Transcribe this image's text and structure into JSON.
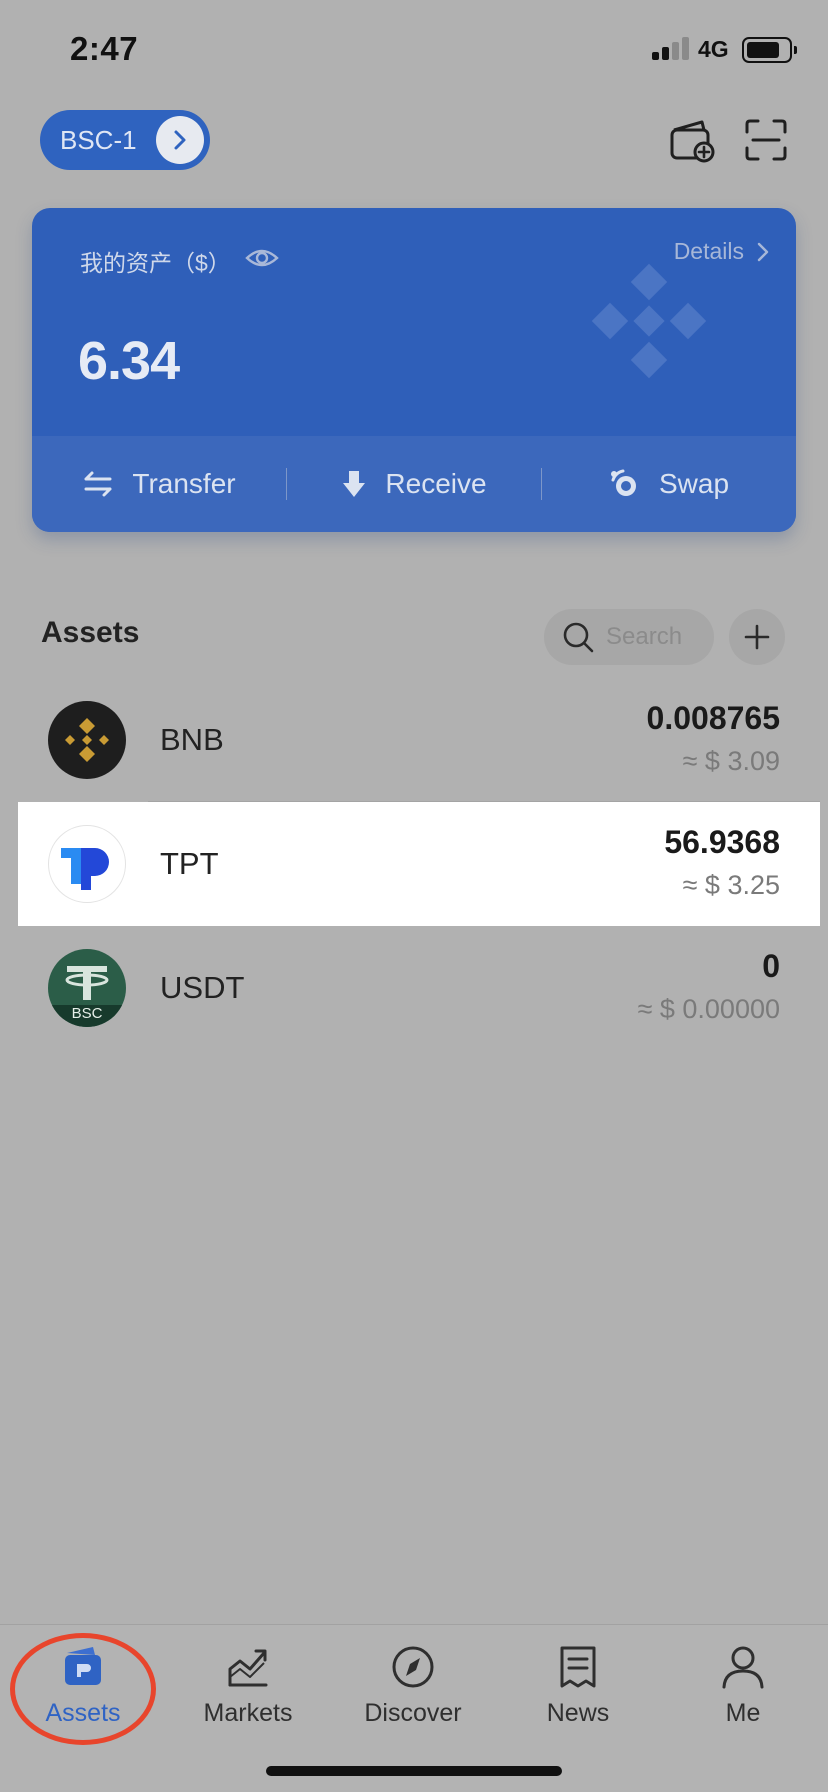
{
  "status_bar": {
    "time": "2:47",
    "network": "4G"
  },
  "header": {
    "wallet_name": "BSC-1"
  },
  "asset_card": {
    "label": "我的资产（$）",
    "details_label": "Details",
    "total": "6.34",
    "actions": [
      {
        "label": "Transfer",
        "icon": "transfer-arrows-icon"
      },
      {
        "label": "Receive",
        "icon": "download-arrow-icon"
      },
      {
        "label": "Swap",
        "icon": "swap-icon"
      }
    ]
  },
  "assets": {
    "title": "Assets",
    "search_placeholder": "Search",
    "tokens": [
      {
        "symbol": "BNB",
        "balance": "0.008765",
        "fiat": "≈ $ 3.09",
        "icon": "bnb-logo-icon",
        "highlighted": false
      },
      {
        "symbol": "TPT",
        "balance": "56.9368",
        "fiat": "≈ $ 3.25",
        "icon": "tpt-logo-icon",
        "highlighted": true
      },
      {
        "symbol": "USDT",
        "balance": "0",
        "fiat": "≈ $ 0.00000",
        "icon": "usdt-logo-icon",
        "badge": "BSC",
        "highlighted": false
      }
    ]
  },
  "bottom_nav": {
    "active": "Assets",
    "items": [
      {
        "label": "Assets",
        "icon": "wallet-icon"
      },
      {
        "label": "Markets",
        "icon": "chart-icon"
      },
      {
        "label": "Discover",
        "icon": "compass-icon"
      },
      {
        "label": "News",
        "icon": "news-icon"
      },
      {
        "label": "Me",
        "icon": "user-icon"
      }
    ]
  },
  "colors": {
    "accent": "#2f63c4",
    "card": "#2f5fb9",
    "overlay_bg": "#b1b1b1",
    "active_ring": "#e8452c",
    "bnb_gold": "#c99b34"
  }
}
